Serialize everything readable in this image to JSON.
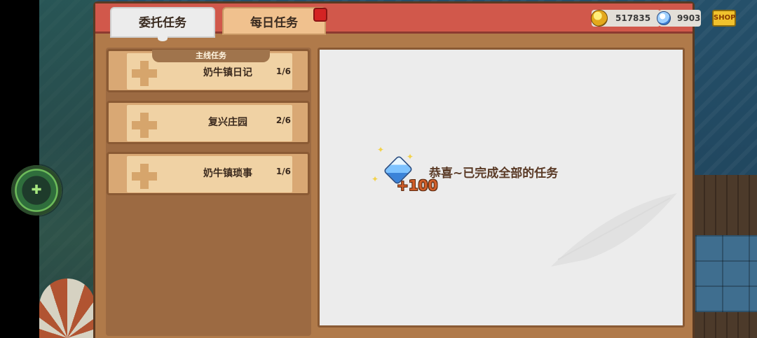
{
  "tabs": [
    {
      "label": "委托任务",
      "active": true
    },
    {
      "label": "每日任务",
      "active": false,
      "notification": true
    }
  ],
  "currency": {
    "coins": "517835",
    "gems": "9903",
    "shop_label": "SHOP"
  },
  "quests": [
    {
      "name": "奶牛镇日记",
      "progress": "1/6",
      "ribbon": "主线任务"
    },
    {
      "name": "复兴庄园",
      "progress": "2/6"
    },
    {
      "name": "奶牛镇琐事",
      "progress": "1/6"
    }
  ],
  "content": {
    "reward_amount": "+100",
    "message": "恭喜~已完成全部的任务"
  },
  "colors": {
    "header": "#d1584b",
    "panel": "#b07a4a",
    "content_bg": "#ececec",
    "accent_text": "#d05e2a"
  },
  "icons": [
    "coin-icon",
    "gem-icon",
    "plus-icon",
    "gamepad-icon",
    "notification-dot"
  ]
}
